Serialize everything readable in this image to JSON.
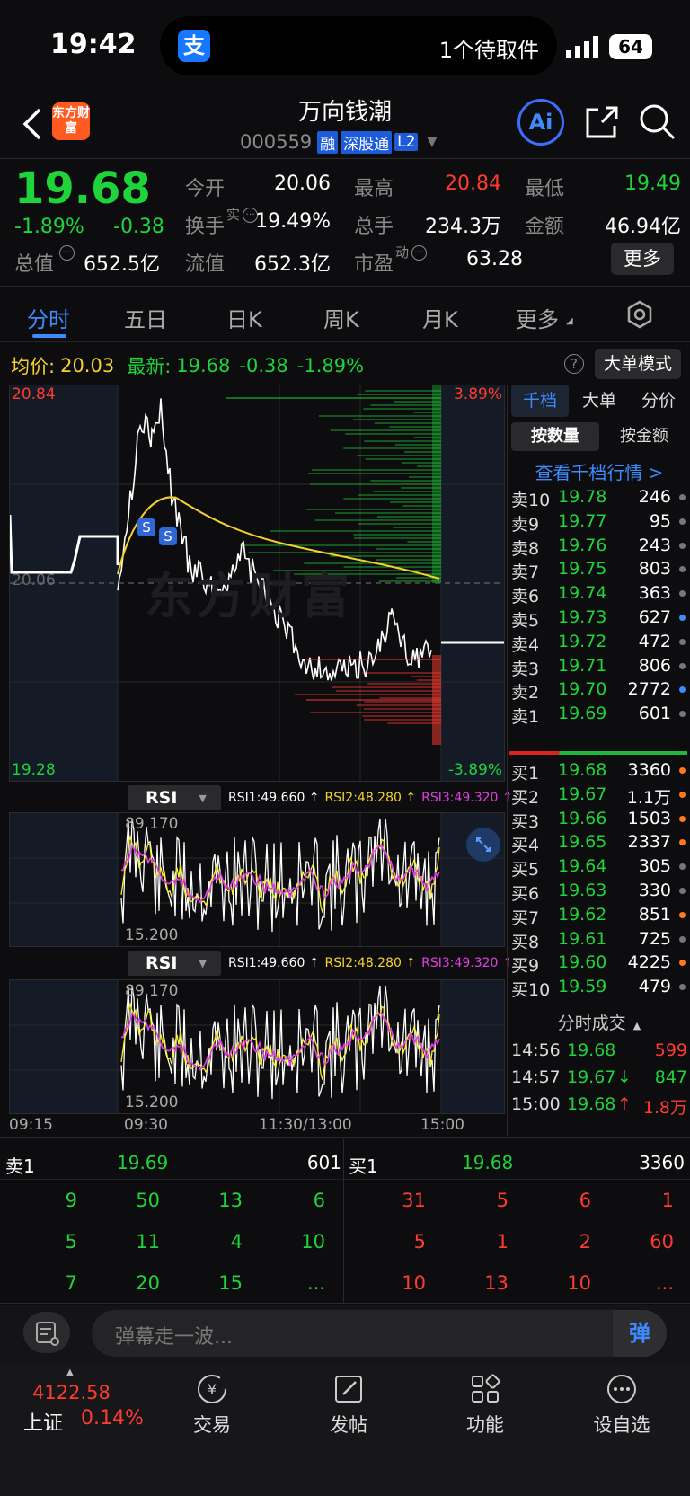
{
  "status_bar": {
    "time": "19:42",
    "app_badge": "支",
    "notification": "1个待取件",
    "battery": "64"
  },
  "header": {
    "title": "万向钱潮",
    "code": "000559",
    "tags": [
      "融",
      "深股通",
      "L2"
    ],
    "logo": "东方财富",
    "ai": "Ai"
  },
  "quote": {
    "price": "19.68",
    "pct": "-1.89%",
    "chg": "-0.38",
    "r1": [
      {
        "l": "今开",
        "v": "20.06",
        "c": "w"
      },
      {
        "l": "最高",
        "v": "20.84",
        "c": "r"
      },
      {
        "l": "最低",
        "v": "19.49",
        "c": "g"
      }
    ],
    "r2": [
      {
        "l": "换手",
        "sup": "实",
        "v": "19.49%"
      },
      {
        "l": "总手",
        "v": "234.3万"
      },
      {
        "l": "金额",
        "v": "46.94亿"
      }
    ],
    "r3": [
      {
        "l": "总值",
        "v": "652.5亿"
      },
      {
        "l": "流值",
        "v": "652.3亿"
      },
      {
        "l": "市盈",
        "sup": "动",
        "v": "63.28"
      }
    ],
    "more": "更多"
  },
  "tabs": [
    "分时",
    "五日",
    "日K",
    "周K",
    "月K",
    "更多"
  ],
  "info": {
    "avg_label": "均价:",
    "avg": "20.03",
    "last_label": "最新:",
    "last": "19.68",
    "chg": "-0.38",
    "pct": "-1.89%",
    "mode": "大单模式"
  },
  "chart": {
    "y_max": "20.84",
    "y_min": "19.28",
    "pct_max": "3.89%",
    "pct_min": "-3.89%",
    "mid": "20.06",
    "x_labels": [
      "09:15",
      "09:30",
      "11:30/13:00",
      "15:00"
    ],
    "watermark": "东方财富",
    "signals": [
      "S",
      "S"
    ]
  },
  "rsi": {
    "label": "RSI",
    "r1": "RSI1:49.660 ↑",
    "r2": "RSI2:48.280 ↑",
    "r3": "RSI3:49.320 ↑",
    "top": "89.170",
    "bottom": "15.200"
  },
  "side": {
    "tabs": [
      "千档",
      "大单",
      "分价"
    ],
    "sub": [
      "按数量",
      "按金额"
    ],
    "link": "查看千档行情 >",
    "sells": [
      {
        "l": "卖10",
        "p": "19.78",
        "q": "246",
        "d": "g"
      },
      {
        "l": "卖9",
        "p": "19.77",
        "q": "95",
        "d": "g"
      },
      {
        "l": "卖8",
        "p": "19.76",
        "q": "243",
        "d": "g"
      },
      {
        "l": "卖7",
        "p": "19.75",
        "q": "803",
        "d": "g"
      },
      {
        "l": "卖6",
        "p": "19.74",
        "q": "363",
        "d": "g"
      },
      {
        "l": "卖5",
        "p": "19.73",
        "q": "627",
        "d": "b"
      },
      {
        "l": "卖4",
        "p": "19.72",
        "q": "472",
        "d": "g"
      },
      {
        "l": "卖3",
        "p": "19.71",
        "q": "806",
        "d": "g"
      },
      {
        "l": "卖2",
        "p": "19.70",
        "q": "2772",
        "d": "b"
      },
      {
        "l": "卖1",
        "p": "19.69",
        "q": "601",
        "d": "g"
      }
    ],
    "buys": [
      {
        "l": "买1",
        "p": "19.68",
        "q": "3360",
        "d": "o"
      },
      {
        "l": "买2",
        "p": "19.67",
        "q": "1.1万",
        "d": "o"
      },
      {
        "l": "买3",
        "p": "19.66",
        "q": "1503",
        "d": "o"
      },
      {
        "l": "买4",
        "p": "19.65",
        "q": "2337",
        "d": "o"
      },
      {
        "l": "买5",
        "p": "19.64",
        "q": "305",
        "d": "g"
      },
      {
        "l": "买6",
        "p": "19.63",
        "q": "330",
        "d": "g"
      },
      {
        "l": "买7",
        "p": "19.62",
        "q": "851",
        "d": "o"
      },
      {
        "l": "买8",
        "p": "19.61",
        "q": "725",
        "d": "g"
      },
      {
        "l": "买9",
        "p": "19.60",
        "q": "4225",
        "d": "o"
      },
      {
        "l": "买10",
        "p": "19.59",
        "q": "479",
        "d": "g"
      }
    ],
    "trade_title": "分时成交",
    "trades": [
      {
        "t": "14:56",
        "p": "19.68",
        "a": "",
        "v": "599",
        "c": "r"
      },
      {
        "t": "14:57",
        "p": "19.67",
        "a": "↓",
        "v": "847",
        "c": "g"
      },
      {
        "t": "15:00",
        "p": "19.68",
        "a": "↑",
        "v": "1.8万",
        "c": "r"
      }
    ]
  },
  "queue": {
    "sell_label": "卖1",
    "sell_price": "19.69",
    "sell_qty": "601",
    "buy_label": "买1",
    "buy_price": "19.68",
    "buy_qty": "3360",
    "sell_cells": [
      [
        "9",
        "50",
        "13",
        "6"
      ],
      [
        "5",
        "11",
        "4",
        "10"
      ],
      [
        "7",
        "20",
        "15",
        "..."
      ]
    ],
    "buy_cells": [
      [
        "31",
        "5",
        "6",
        "1"
      ],
      [
        "5",
        "1",
        "2",
        "60"
      ],
      [
        "10",
        "13",
        "10",
        "..."
      ]
    ]
  },
  "comment": {
    "placeholder": "弹幕走一波...",
    "send": "弹"
  },
  "bottom": {
    "index_value": "4122.58",
    "index_name": "上证",
    "index_pct": "0.14%",
    "items": [
      "交易",
      "发帖",
      "功能",
      "设自选"
    ]
  }
}
